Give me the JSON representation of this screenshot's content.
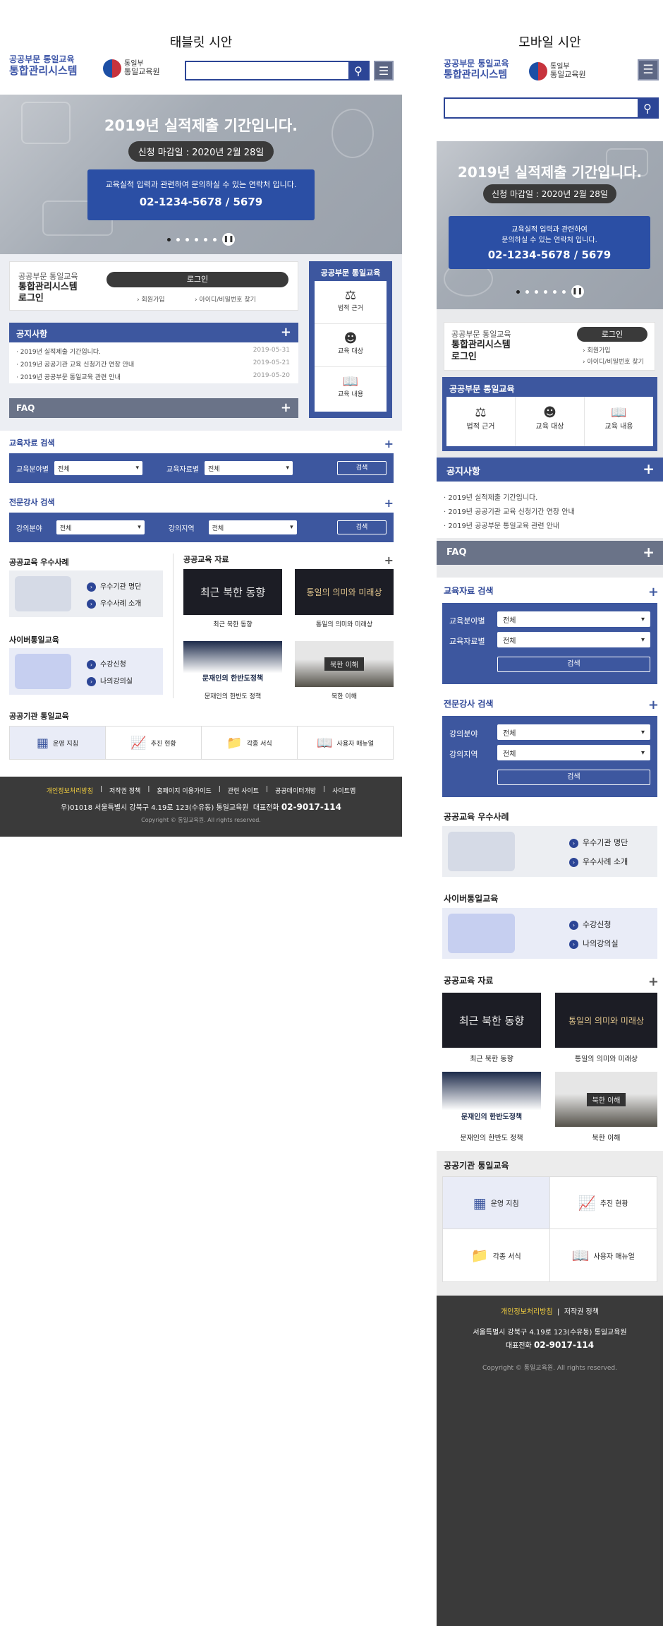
{
  "captions": {
    "tablet": "태블릿 시안",
    "mobile": "모바일 시안"
  },
  "header": {
    "logo_line1": "공공부문 통일교육",
    "logo_line2": "통합관리시스템",
    "gov_line1": "통일부",
    "gov_line2": "통일교육원"
  },
  "hero": {
    "title": "2019년 실적제출 기간입니다.",
    "deadline": "신청 마감일 : 2020년 2월 28일",
    "contact_desc": "교육실적 입력과 관련하여 문의하실 수 있는 연락처 입니다.",
    "contact_desc_m1": "교육실적 입력과 관련하여",
    "contact_desc_m2": "문의하실 수 있는 연락처 입니다.",
    "phone": "02-1234-5678 / 5679"
  },
  "login": {
    "sub": "공공부문 통일교육",
    "title1": "통합관리시스템",
    "title2": "로그인",
    "button": "로그인",
    "join": "회원가입",
    "find": "아이디/비밀번호 찾기"
  },
  "quick": {
    "title": "공공부문 통일교육",
    "items": [
      {
        "label": "법적 근거",
        "icon": "scale-icon"
      },
      {
        "label": "교육 대상",
        "icon": "person-icon"
      },
      {
        "label": "교육 내용",
        "icon": "book-icon"
      }
    ]
  },
  "notice": {
    "title": "공지사항",
    "items": [
      {
        "text": "2019년 실적제출 기간입니다.",
        "date": "2019-05-31"
      },
      {
        "text": "2019년 공공기관 교육 신청기간 연장 안내",
        "date": "2019-05-21"
      },
      {
        "text": "2019년 공공부문 통일교육 관련 안내",
        "date": "2019-05-20"
      }
    ]
  },
  "faq": {
    "title": "FAQ"
  },
  "material_search": {
    "title": "교육자료 검색",
    "field1": "교육분야별",
    "field2": "교육자료별",
    "value": "전체",
    "button": "검색"
  },
  "lecturer_search": {
    "title": "전문강사 검색",
    "field1": "강의분야",
    "field2": "강의지역",
    "value": "전체",
    "button": "검색"
  },
  "best": {
    "title": "공공교육 우수사례",
    "link1": "우수기관 명단",
    "link2": "우수사례 소개"
  },
  "cyber": {
    "title": "사이버통일교육",
    "link1": "수강신청",
    "link2": "나의강의실"
  },
  "materials": {
    "title": "공공교육 자료",
    "items": [
      {
        "caption": "최근 북한 동향",
        "thumb": "최근 북한 동향"
      },
      {
        "caption": "통일의 의미와 미래상",
        "thumb": "통일의 의미와 미래상"
      },
      {
        "caption": "문재인의 한반도 정책",
        "thumb": "문재인의 한반도정책"
      },
      {
        "caption": "북한 이해",
        "thumb": "북한 이해"
      }
    ]
  },
  "agency": {
    "title": "공공기관 통일교육",
    "items": [
      {
        "label": "운영 지침",
        "icon": "cubes-icon"
      },
      {
        "label": "추진 현황",
        "icon": "chart-monitor-icon"
      },
      {
        "label": "각종 서식",
        "icon": "folder-icon"
      },
      {
        "label": "사용자 매뉴얼",
        "icon": "manual-icon"
      }
    ]
  },
  "footer": {
    "links": [
      "개인정보처리방침",
      "저작권 정책",
      "홈페이지 이용가이드",
      "관련 사이트",
      "공공데이터개방",
      "사이트맵"
    ],
    "address": "우)01018 서울특별시 강북구 4.19로 123(수유동) 통일교육원",
    "address_m": "서울특별시 강북구 4.19로 123(수유동) 통일교육원",
    "tel_label": "대표전화",
    "tel": "02-9017-114",
    "copy": "Copyright © 통일교육원. All rights reserved."
  },
  "colors": {
    "navy": "#3d579f",
    "accent_yellow": "#f4d03f"
  }
}
